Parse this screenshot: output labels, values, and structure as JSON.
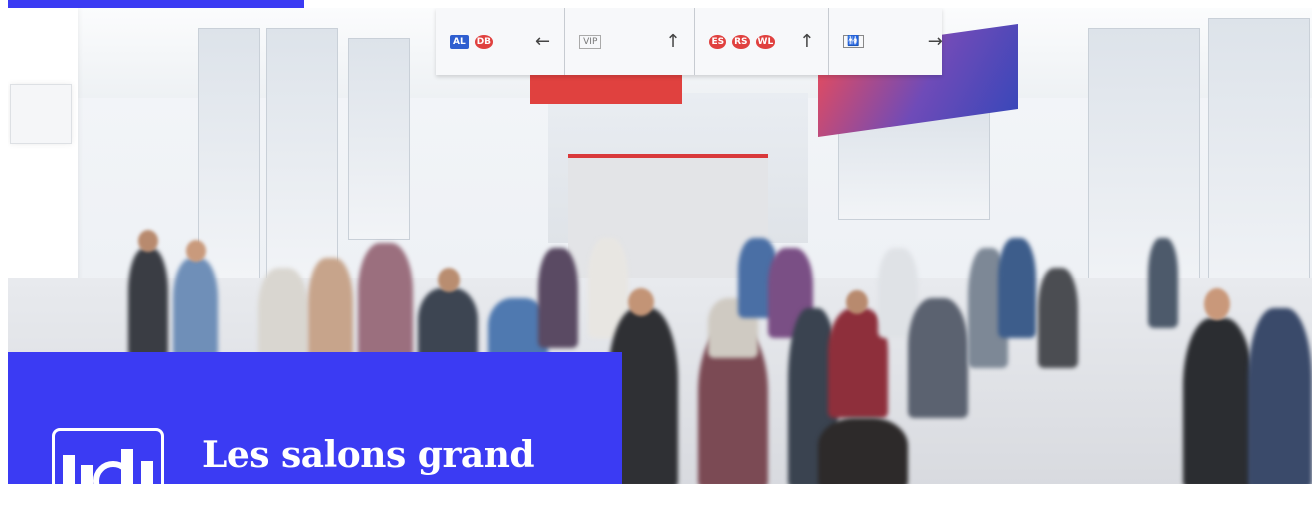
{
  "sign": {
    "seg1_codes": [
      "AL",
      "DB"
    ],
    "seg1_arrow": "←",
    "seg2_label": "VIP",
    "seg2_arrow": "↑",
    "seg3_codes": [
      "ES",
      "RS",
      "WL"
    ],
    "seg3_arrow": "↑",
    "seg4_label": "🚻",
    "seg4_arrow": "→"
  },
  "card": {
    "title": "Les salons grand public et les"
  },
  "colors": {
    "accent": "#3b3bf3",
    "sign_red": "#e0413f",
    "sign_blue": "#2f5fd0"
  },
  "icons": {
    "card_icon": "event-venue-gear-icon"
  }
}
